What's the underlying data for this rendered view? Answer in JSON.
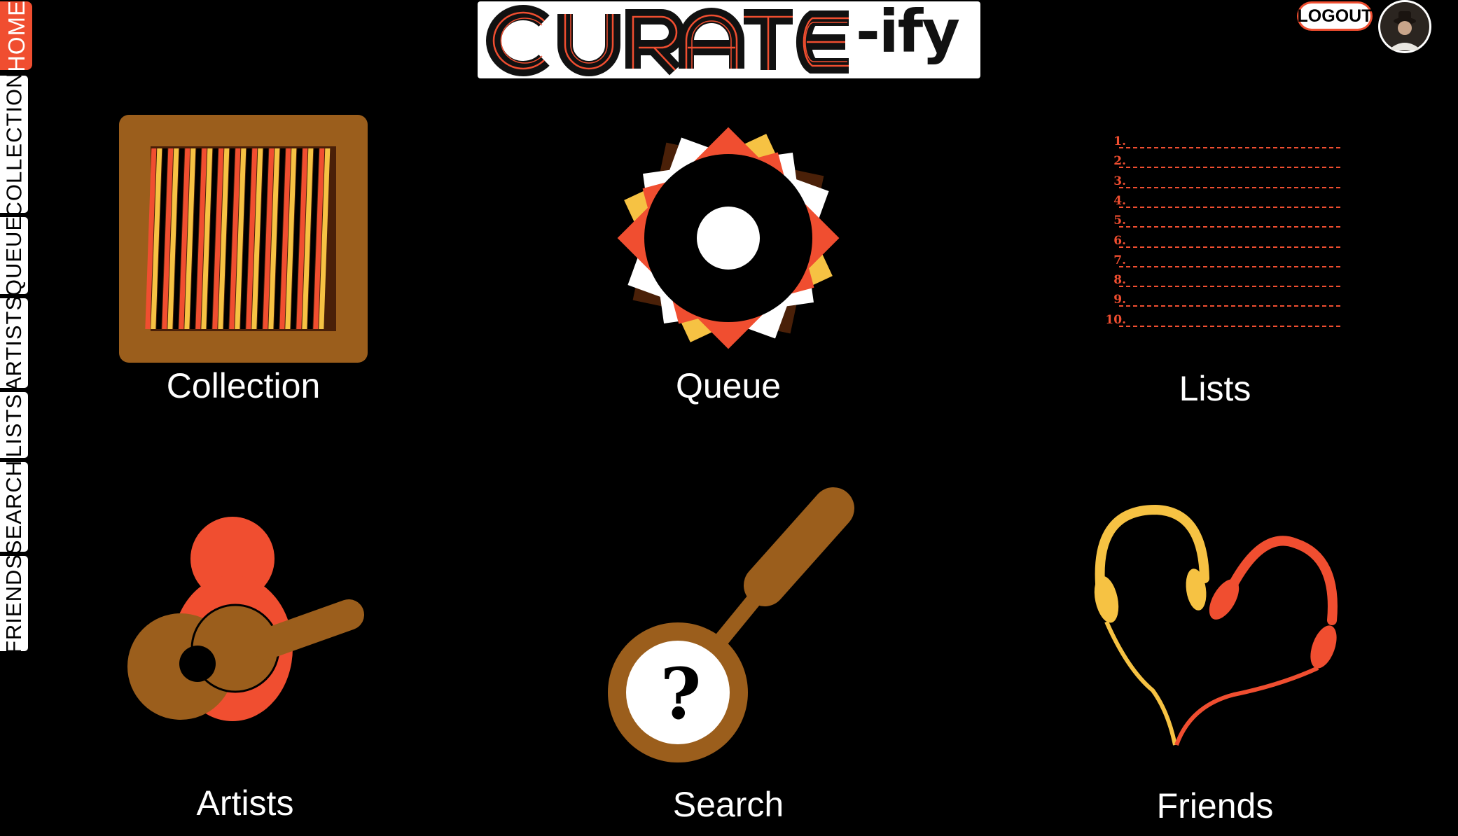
{
  "logo": {
    "main_text": "CURATE",
    "suffix": "-ify"
  },
  "nav": {
    "items": [
      {
        "label": "HOME",
        "active": true
      },
      {
        "label": "COLLECTION",
        "active": false
      },
      {
        "label": "QUEUE",
        "active": false
      },
      {
        "label": "ARTISTS",
        "active": false
      },
      {
        "label": "LISTS",
        "active": false
      },
      {
        "label": "SEARCH",
        "active": false
      },
      {
        "label": "FRIENDS",
        "active": false
      }
    ]
  },
  "header": {
    "logout_label": "LOGOUT",
    "avatar_icon": "user-avatar"
  },
  "tiles": {
    "collection": {
      "label": "Collection",
      "icon": "record-crate-icon"
    },
    "queue": {
      "label": "Queue",
      "icon": "vinyl-record-icon"
    },
    "lists": {
      "label": "Lists",
      "icon": "numbered-list-icon",
      "numbers": [
        "1.",
        "2.",
        "3.",
        "4.",
        "5.",
        "6.",
        "7.",
        "8.",
        "9.",
        "10."
      ]
    },
    "artists": {
      "label": "Artists",
      "icon": "guitarist-icon"
    },
    "search": {
      "label": "Search",
      "icon": "magnifying-glass-icon",
      "glyph": "?"
    },
    "friends": {
      "label": "Friends",
      "icon": "headphones-heart-icon"
    }
  },
  "colors": {
    "accent": "#f04e30",
    "brown": "#9b5e1c",
    "yellow": "#f6c243",
    "dark_brown": "#4a2008",
    "background": "#000000"
  }
}
